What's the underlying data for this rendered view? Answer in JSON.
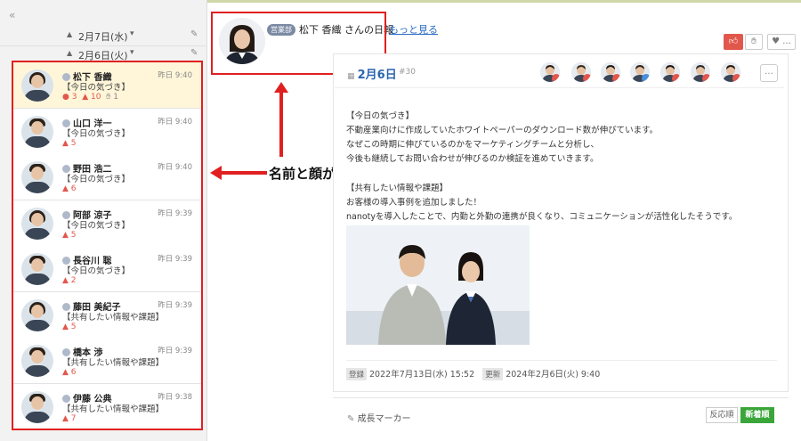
{
  "sidebar": {
    "collapse_glyph": "«",
    "dates": [
      {
        "label": "2月7日(水)",
        "caret": "▾",
        "tri": "▲"
      },
      {
        "label": "2月6日(火)",
        "caret": "▾",
        "tri": "▲"
      }
    ],
    "items": [
      {
        "name": "松下 香織",
        "time": "昨日 9:40",
        "category": "【今日の気づき】",
        "comments": "3",
        "likes": "10",
        "extra": "1",
        "active": true,
        "gender": "f"
      },
      {
        "name": "山口 洋一",
        "time": "昨日 9:40",
        "category": "【今日の気づき】",
        "likes": "5",
        "gender": "m"
      },
      {
        "name": "野田 浩二",
        "time": "昨日 9:40",
        "category": "【今日の気づき】",
        "likes": "6",
        "gender": "m"
      },
      {
        "name": "阿部 涼子",
        "time": "昨日 9:39",
        "category": "【今日の気づき】",
        "likes": "5",
        "gender": "f"
      },
      {
        "name": "長谷川 聡",
        "time": "昨日 9:39",
        "category": "【今日の気づき】",
        "likes": "2",
        "gender": "m"
      },
      {
        "name": "藤田 美紀子",
        "time": "昨日 9:39",
        "category": "【共有したい情報や課題】",
        "likes": "5",
        "gender": "f"
      },
      {
        "name": "橋本 渉",
        "time": "昨日 9:39",
        "category": "【共有したい情報や課題】",
        "likes": "6",
        "gender": "m"
      },
      {
        "name": "伊藤 公典",
        "time": "昨日 9:38",
        "category": "【共有したい情報や課題】",
        "likes": "7",
        "gender": "m"
      }
    ]
  },
  "header": {
    "dept": "営業部",
    "title": "松下 香織 さんの日報",
    "more_link": "もっと見る"
  },
  "toolbar": {
    "heart": "♥ ..."
  },
  "card": {
    "date": "2月6日",
    "number": "#30",
    "menu": "…",
    "body_lines": [
      "【今日の気づき】",
      "不動産業向けに作成していたホワイトペーパーのダウンロード数が伸びています。",
      "なぜこの時期に伸びているのかをマーケティングチームと分析し、",
      "今後も継続してお問い合わせが伸びるのか検証を進めていきます。",
      "【共有したい情報や課題】",
      "お客様の導入事例を追加しました！",
      "nanotyを導入したことで、内勤と外勤の連携が良くなり、コミュニケーションが活性化したそうです。"
    ],
    "registered_tag": "登録",
    "registered": "2022年7月13日(水) 15:52",
    "updated_tag": "更新",
    "updated": "2024年2月6日(火) 9:40"
  },
  "footer": {
    "marker": "成長マーカー",
    "sort_reaction": "反応順",
    "sort_new": "新着順"
  },
  "annotation": {
    "text": "名前と顔が一致"
  },
  "colors": {
    "accent_red": "#e2574c",
    "highlight_box": "#e02020",
    "link_blue": "#2b6cc4",
    "green": "#3aa63a"
  }
}
